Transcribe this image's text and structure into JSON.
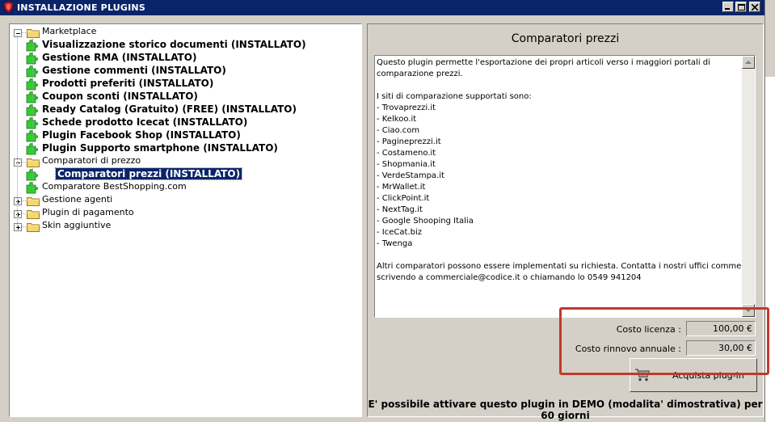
{
  "window": {
    "title": "INSTALLAZIONE PLUGINS"
  },
  "tree": {
    "nodes": [
      {
        "label": "Marketplace",
        "kind": "folder",
        "expanded": true,
        "bold": false
      },
      {
        "label": "Visualizzazione storico documenti (INSTALLATO)",
        "kind": "plugin",
        "bold": true
      },
      {
        "label": "Gestione RMA (INSTALLATO)",
        "kind": "plugin",
        "bold": true
      },
      {
        "label": "Gestione commenti (INSTALLATO)",
        "kind": "plugin",
        "bold": true
      },
      {
        "label": "Prodotti preferiti (INSTALLATO)",
        "kind": "plugin",
        "bold": true
      },
      {
        "label": "Coupon sconti (INSTALLATO)",
        "kind": "plugin",
        "bold": true
      },
      {
        "label": "Ready Catalog (Gratuito) (FREE) (INSTALLATO)",
        "kind": "plugin",
        "bold": true
      },
      {
        "label": "Schede prodotto Icecat (INSTALLATO)",
        "kind": "plugin",
        "bold": true
      },
      {
        "label": "Plugin Facebook Shop (INSTALLATO)",
        "kind": "plugin",
        "bold": true
      },
      {
        "label": "Plugin Supporto smartphone (INSTALLATO)",
        "kind": "plugin",
        "bold": true
      },
      {
        "label": "Comparatori di prezzo",
        "kind": "folder",
        "expanded": true,
        "bold": false
      },
      {
        "label": "Comparatori prezzi (INSTALLATO)",
        "kind": "plugin",
        "bold": true,
        "selected": true
      },
      {
        "label": "Comparatore BestShopping.com",
        "kind": "plugin",
        "bold": false
      },
      {
        "label": "Gestione agenti",
        "kind": "folder",
        "expanded": false,
        "bold": false
      },
      {
        "label": "Plugin di pagamento",
        "kind": "folder",
        "expanded": false,
        "bold": false
      },
      {
        "label": "Skin aggiuntive",
        "kind": "folder",
        "expanded": false,
        "bold": false
      }
    ]
  },
  "detail": {
    "title": "Comparatori prezzi",
    "description": "Questo plugin permette l'esportazione dei propri articoli verso i maggiori portali di\ncomparazione prezzi.\n\nI siti di comparazione supportati sono:\n- Trovaprezzi.it\n- Kelkoo.it\n- Ciao.com\n- Pagineprezzi.it\n- Costameno.it\n- Shopmania.it\n- VerdeStampa.it\n- MrWallet.it\n- ClickPoint.it\n- NextTag.it\n- Google Shooping Italia\n- IceCat.biz\n- Twenga\n\nAltri comparatori possono essere implementati su richiesta. Contatta i nostri uffici commerciali\nscrivendo a commerciale@codice.it o chiamando lo 0549 941204",
    "license_label": "Costo licenza :",
    "license_value": "100,00 €",
    "renewal_label": "Costo rinnovo annuale :",
    "renewal_value": "30,00 €",
    "buy_label": "Acquista plug-in",
    "demo_notice": "E' possibile attivare questo plugin in DEMO (modalita' dimostrativa) per 60 giorni"
  },
  "colors": {
    "titlebar": "#0a246a",
    "highlight": "#c0392b",
    "plugin_green": "#33cc33",
    "folder_yellow": "#f5d76e"
  }
}
